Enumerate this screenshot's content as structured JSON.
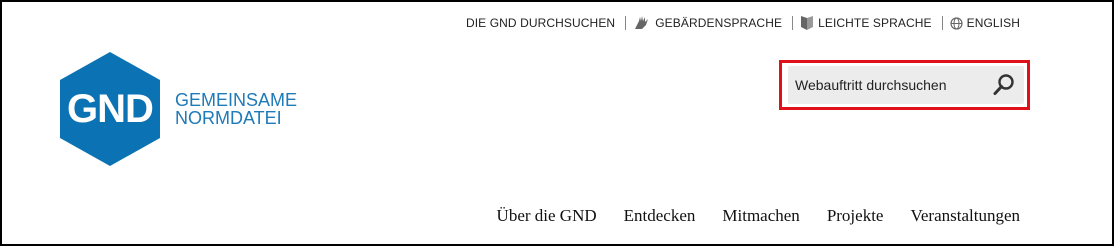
{
  "top_nav": {
    "search_gnd": "DIE GND DURCHSUCHEN",
    "sign_language": "GEBÄRDENSPRACHE",
    "easy_language": "LEICHTE SPRACHE",
    "english": "ENGLISH",
    "icons": [
      "hand-icon",
      "book-icon",
      "globe-icon"
    ]
  },
  "logo": {
    "short": "GND",
    "line1": "GEMEINSAME",
    "line2": "NORMDATEI",
    "color": "#0b73b3",
    "text_color": "#1f7ab8"
  },
  "search": {
    "placeholder": "Webauftritt durchsuchen",
    "value": "",
    "icon": "search-icon",
    "highlight_color": "#e0101a"
  },
  "main_nav": {
    "items": [
      {
        "label": "Über die GND"
      },
      {
        "label": "Entdecken"
      },
      {
        "label": "Mitmachen"
      },
      {
        "label": "Projekte"
      },
      {
        "label": "Veranstaltungen"
      }
    ]
  }
}
